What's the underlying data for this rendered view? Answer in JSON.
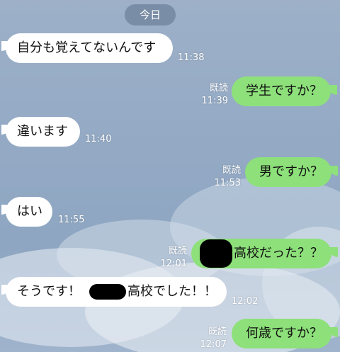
{
  "date_label": "今日",
  "messages": [
    {
      "side": "in",
      "text": "自分も覚えてないんです",
      "time": "11:38"
    },
    {
      "side": "out",
      "read": "既読",
      "time": "11:39",
      "text": "学生ですか？"
    },
    {
      "side": "in",
      "text": "違います",
      "time": "11:40"
    },
    {
      "side": "out",
      "read": "既読",
      "time": "11:53",
      "text": "男ですか？"
    },
    {
      "side": "in",
      "text": "はい",
      "time": "11:55"
    },
    {
      "side": "out",
      "read": "既読",
      "time": "12:01",
      "text": "高校だった？？"
    },
    {
      "side": "in",
      "text_before": "そうです！",
      "text_after": "高校でした！！",
      "time": "12:02"
    },
    {
      "side": "out",
      "read": "既読",
      "time": "12:07",
      "text": "何歳ですか？"
    }
  ],
  "colors": {
    "out_bubble": "#8de07a",
    "in_bubble": "#ffffff"
  }
}
